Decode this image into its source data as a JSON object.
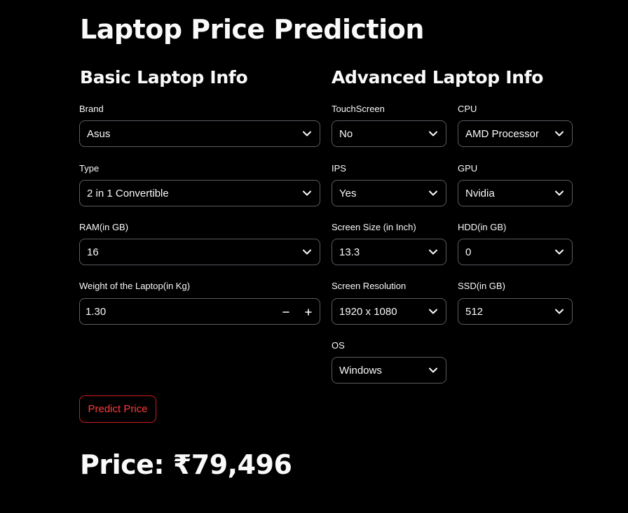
{
  "title": "Laptop Price Prediction",
  "basic": {
    "heading": "Basic Laptop Info",
    "brand": {
      "label": "Brand",
      "value": "Asus"
    },
    "type": {
      "label": "Type",
      "value": "2 in 1 Convertible"
    },
    "ram": {
      "label": "RAM(in GB)",
      "value": "16"
    },
    "weight": {
      "label": "Weight of the Laptop(in Kg)",
      "value": "1.30",
      "minus": "−",
      "plus": "+"
    }
  },
  "advanced": {
    "heading": "Advanced Laptop Info",
    "touchscreen": {
      "label": "TouchScreen",
      "value": "No"
    },
    "ips": {
      "label": "IPS",
      "value": "Yes"
    },
    "screen_size": {
      "label": "Screen Size (in Inch)",
      "value": "13.3"
    },
    "resolution": {
      "label": "Screen Resolution",
      "value": "1920 x 1080"
    },
    "os": {
      "label": "OS",
      "value": "Windows"
    },
    "cpu": {
      "label": "CPU",
      "value": "AMD Processor"
    },
    "gpu": {
      "label": "GPU",
      "value": "Nvidia"
    },
    "hdd": {
      "label": "HDD(in GB)",
      "value": "0"
    },
    "ssd": {
      "label": "SSD(in GB)",
      "value": "512"
    }
  },
  "predict_button": "Predict Price",
  "result": "Price: ₹79,496",
  "colors": {
    "background": "#000000",
    "text": "#fafafa",
    "border": "#5b5b63",
    "accent": "#ff3b3b"
  },
  "icons": {
    "dropdown": "chevron-down-icon",
    "decrement": "minus-icon",
    "increment": "plus-icon"
  }
}
